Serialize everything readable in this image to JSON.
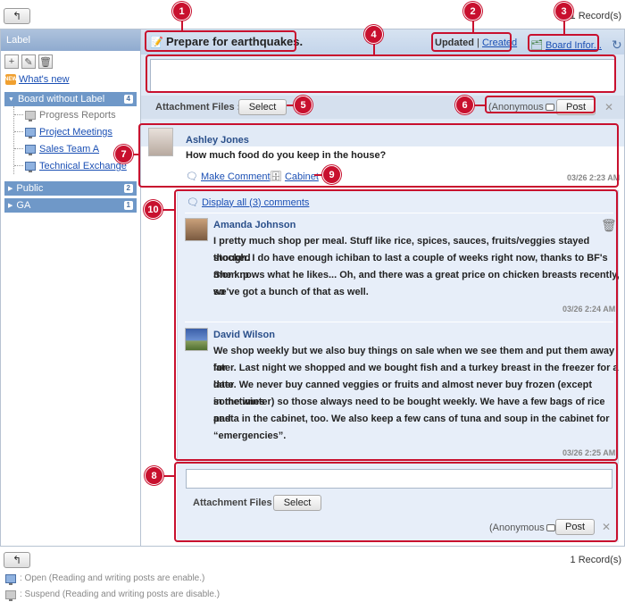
{
  "top": {
    "records": "1 Record(s)"
  },
  "sidebar": {
    "header": "Label",
    "whats_new": "What's new",
    "group1": {
      "label": "Board without Label",
      "count": "4"
    },
    "items": [
      "Progress Reports",
      "Project Meetings",
      "Sales Team A",
      "Technical Exchange"
    ],
    "group2": {
      "label": "Public",
      "count": "2"
    },
    "group3": {
      "label": "GA",
      "count": "1"
    }
  },
  "board": {
    "title": "Prepare for earthquakes.",
    "sort_updated": "Updated",
    "sort_sep": "|",
    "sort_created": "Created",
    "board_info": "Board Infor..."
  },
  "postform": {
    "attach_label": "Attachment Files :",
    "select_label": "Select",
    "anonymous_label": "(Anonymous",
    "anonymous_close": ")",
    "post_label": "Post"
  },
  "post": {
    "author": "Ashley Jones",
    "body": "How much food do you keep in the house?",
    "make_comment": "Make Comment",
    "cabinet": "Cabinet",
    "time": "03/26 2:23 AM"
  },
  "comments": {
    "display_all": "Display all (3) comments",
    "items": [
      {
        "author": "Amanda Johnson",
        "lines": [
          "I pretty much shop per meal. Stuff like rice, spices, sauces, fruits/veggies stayed stocked",
          "though. I do have enough ichiban to last a couple of weeks right now, thanks to BF's mom :p",
          "She knows what he likes... Oh, and there was a great price on chicken breasts recently, so",
          "we've got a bunch of that as well."
        ],
        "time": "03/26 2:24 AM"
      },
      {
        "author": "David Wilson",
        "lines": [
          "We shop weekly but we also buy things on sale when we see them and put them away for",
          "later. Last night we shopped and we bought fish and a turkey breast in the freezer for a later",
          "date. We never buy canned veggies or fruits and almost never buy frozen (except sometimes",
          "in the winter) so those always need to be bought weekly. We have a few bags of rice and",
          "pasta in the cabinet, too. We also keep a few cans of tuna and soup in the cabinet for",
          "“emergencies”."
        ],
        "time": "03/26 2:25 AM"
      }
    ]
  },
  "reply": {
    "attach_label": "Attachment Files :",
    "select_label": "Select",
    "anonymous_label": "(Anonymous",
    "anonymous_close": ")",
    "post_label": "Post"
  },
  "bottom": {
    "records": "1 Record(s)",
    "legend_open": ": Open (Reading and writing posts are enable.)",
    "legend_suspend": ": Suspend (Reading and writing posts are disable.)"
  },
  "markers": [
    "1",
    "2",
    "3",
    "4",
    "5",
    "6",
    "7",
    "8",
    "9",
    "10"
  ],
  "colors": {
    "marker": "#c8102e",
    "link": "#1a4fb4",
    "header": "#8fabcf"
  }
}
